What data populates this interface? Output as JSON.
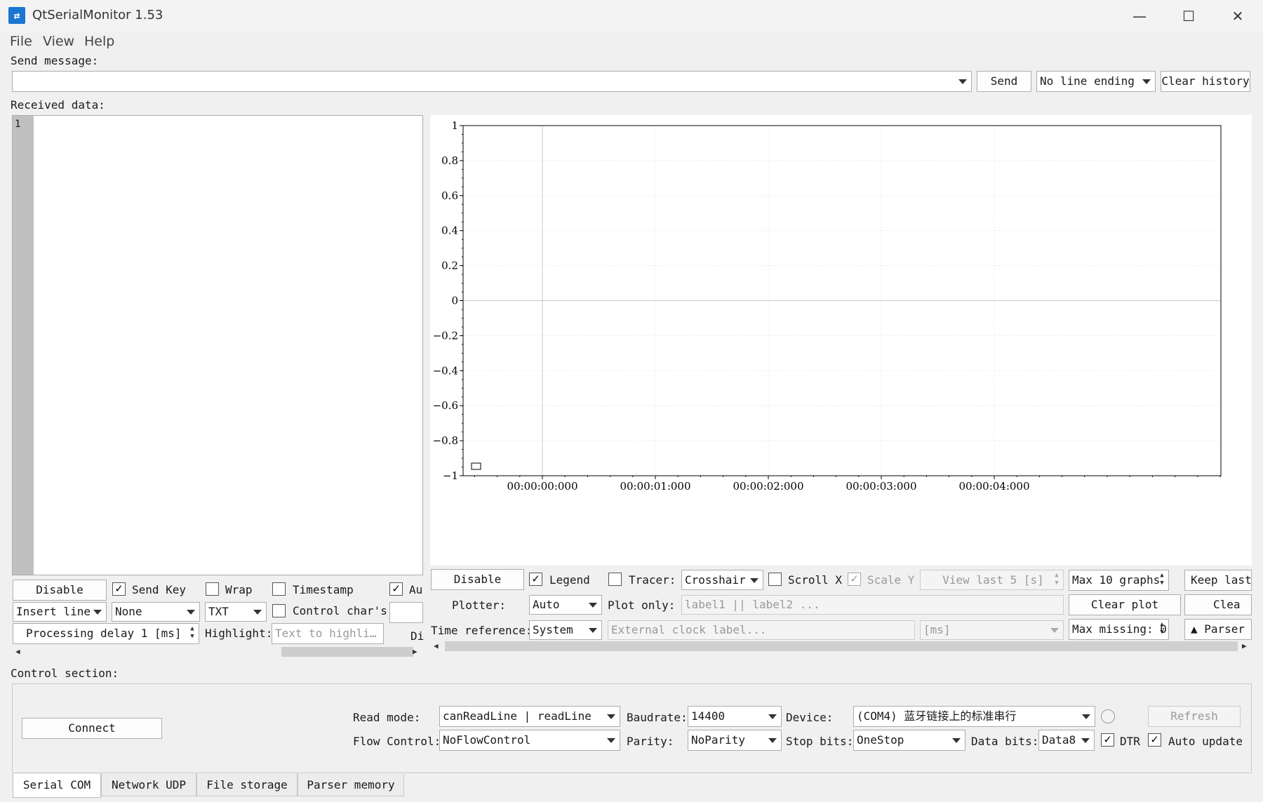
{
  "window": {
    "title": "QtSerialMonitor 1.53",
    "minimize": "—",
    "maximize": "☐",
    "close": "✕"
  },
  "menu": [
    "File",
    "View",
    "Help"
  ],
  "send": {
    "label": "Send message:",
    "input_value": "",
    "send_button": "Send",
    "line_ending": "No line ending",
    "clear_history": "Clear history"
  },
  "received": {
    "label": "Received data:",
    "line_number": "1"
  },
  "text_controls": {
    "disable": "Disable",
    "send_key": "Send Key",
    "wrap": "Wrap",
    "timestamp": "Timestamp",
    "auto": "Au",
    "send_key_checked": true,
    "wrap_checked": false,
    "timestamp_checked": false,
    "auto_checked": true,
    "insert_mode": "Insert line",
    "encoding": "None",
    "format": "TXT",
    "control_chars": "Control char's",
    "control_chars_checked": false,
    "processing_delay": "Processing delay 1 [ms]",
    "highlight_label": "Highlight:",
    "highlight_placeholder": "Text to highli…",
    "di": "Di"
  },
  "plot_controls": {
    "disable": "Disable",
    "legend": "Legend",
    "legend_checked": true,
    "tracer": "Tracer:",
    "tracer_checked": false,
    "tracer_mode": "Crosshair",
    "scroll_x": "Scroll X",
    "scroll_x_checked": false,
    "scale_y": "Scale Y",
    "scale_y_checked": true,
    "view_last": "View last 5 [s]",
    "max_graphs": "Max 10 graphs",
    "keep_last": "Keep last",
    "plotter_label": "Plotter:",
    "plotter": "Auto",
    "plot_only_label": "Plot only:",
    "plot_only_placeholder": "label1 || label2 ...",
    "clear_plot": "Clear plot",
    "clear_short": "Clea",
    "time_ref_label": "Time reference:",
    "time_ref": "System",
    "external_clock_placeholder": "External clock label...",
    "ms_unit": "[ms]",
    "max_missing": "Max missing: 0",
    "parser": "▲ Parser c"
  },
  "chart_data": {
    "type": "line",
    "series": [],
    "ylim": [
      -1,
      1
    ],
    "yticks": [
      "1",
      "0.8",
      "0.6",
      "0.4",
      "0.2",
      "0",
      "−0.2",
      "−0.4",
      "−0.6",
      "−0.8",
      "−1"
    ],
    "xticks": [
      "00:00:00:000",
      "00:00:01:000",
      "00:00:02:000",
      "00:00:03:000",
      "00:00:04:000"
    ],
    "grid": true,
    "legend": "bottom-left"
  },
  "control": {
    "label": "Control section:",
    "connect": "Connect",
    "read_mode_label": "Read mode:",
    "read_mode": "canReadLine | readLine",
    "baudrate_label": "Baudrate:",
    "baudrate": "14400",
    "device_label": "Device:",
    "device": "(COM4) 蓝牙链接上的标准串行",
    "refresh": "Refresh",
    "flow_label": "Flow Control:",
    "flow": "NoFlowControl",
    "parity_label": "Parity:",
    "parity": "NoParity",
    "stop_label": "Stop bits:",
    "stop": "OneStop",
    "data_label": "Data bits:",
    "data": "Data8",
    "dtr": "DTR",
    "dtr_checked": true,
    "auto_update": "Auto update",
    "auto_update_checked": true
  },
  "tabs": [
    "Serial COM",
    "Network UDP",
    "File storage",
    "Parser memory"
  ]
}
